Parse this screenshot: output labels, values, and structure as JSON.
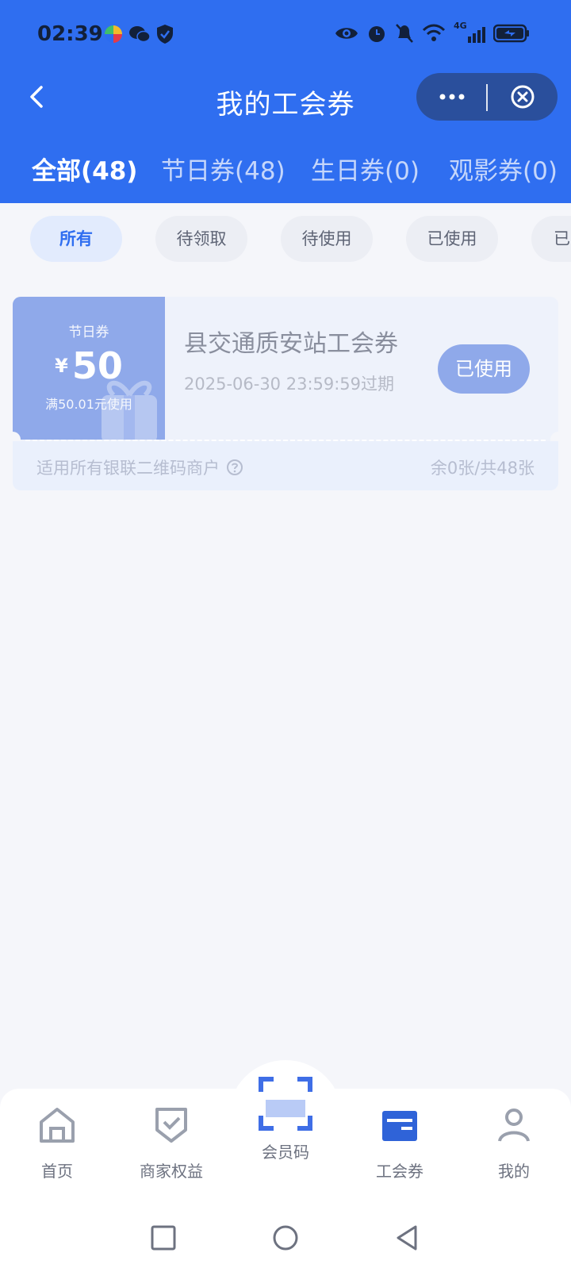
{
  "status_bar": {
    "time": "02:39",
    "network": "4G",
    "left_icons": [
      "pinwheel-app-icon",
      "wechat-icon",
      "shield-icon"
    ],
    "right_icons": [
      "eye-icon",
      "alarm-icon",
      "mute-icon",
      "wifi-icon",
      "signal-icon",
      "battery-icon"
    ]
  },
  "nav": {
    "title": "我的工会券",
    "back_icon": "chevron-left-icon",
    "more_icon": "more-dots-icon",
    "close_icon": "close-circle-icon"
  },
  "tabs": [
    {
      "label": "全部(48)",
      "active": true
    },
    {
      "label": "节日券(48)",
      "active": false
    },
    {
      "label": "生日券(0)",
      "active": false
    },
    {
      "label": "观影券(0)",
      "active": false
    }
  ],
  "filters": [
    {
      "label": "所有",
      "active": true
    },
    {
      "label": "待领取",
      "active": false
    },
    {
      "label": "待使用",
      "active": false
    },
    {
      "label": "已使用",
      "active": false
    },
    {
      "label": "已",
      "active": false
    }
  ],
  "coupon": {
    "type": "节日券",
    "currency": "¥",
    "amount": "50",
    "condition": "满50.01元使用",
    "name": "县交通质安站工会券",
    "expiry": "2025-06-30 23:59:59过期",
    "status_button": "已使用",
    "scope": "适用所有银联二维码商户",
    "remain": "余0张/共48张"
  },
  "tabbar": [
    {
      "label": "首页",
      "icon": "home-icon"
    },
    {
      "label": "商家权益",
      "icon": "shield-check-icon"
    },
    {
      "label": "会员码",
      "icon": "scan-icon"
    },
    {
      "label": "工会券",
      "icon": "card-icon"
    },
    {
      "label": "我的",
      "icon": "person-icon"
    }
  ],
  "colors": {
    "primary": "#2f6ef0",
    "coupon_used": "#8fa9ea",
    "background": "#f5f6fa"
  }
}
